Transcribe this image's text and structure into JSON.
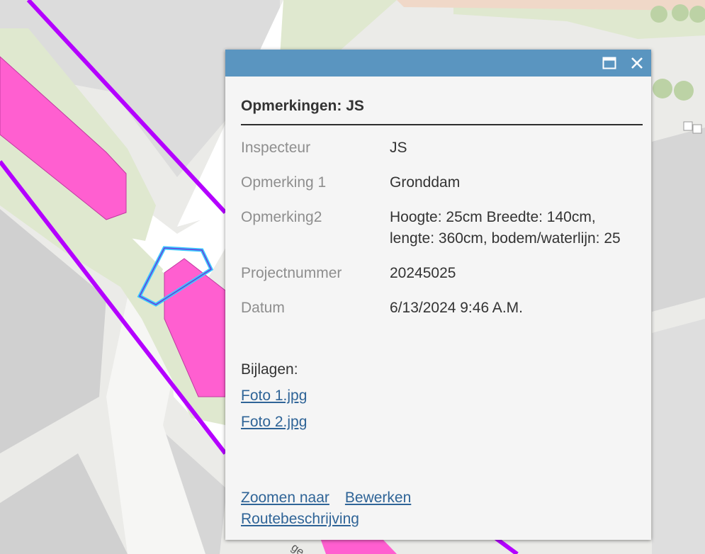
{
  "popup": {
    "title": "Opmerkingen: JS",
    "attributes": [
      {
        "label": "Inspecteur",
        "value": "JS"
      },
      {
        "label": "Opmerking 1",
        "value": "Gronddam"
      },
      {
        "label": "Opmerking2",
        "value": "Hoogte: 25cm Breedte: 140cm, lengte: 360cm, bodem/waterlijn: 25"
      },
      {
        "label": "Projectnummer",
        "value": "20245025"
      },
      {
        "label": "Datum",
        "value": "6/13/2024 9:46 A.M."
      }
    ],
    "attachments_label": "Bijlagen:",
    "attachments": [
      "Foto 1.jpg",
      "Foto 2.jpg"
    ],
    "actions": {
      "zoom": "Zoomen naar",
      "edit": "Bewerken",
      "route": "Routebeschrijving"
    },
    "header_icons": [
      "maximize-icon",
      "close-icon"
    ]
  },
  "map": {
    "street_label_fragment": "ge",
    "colors": {
      "background": "#ebebe8",
      "road": "#ffffff",
      "building": "#d3d3d3",
      "green": "#dfe8cf",
      "pink_feature": "#ff5fd0",
      "purple_line": "#b400ff",
      "cyan_outline": "#3cc8ff",
      "header": "#5a95c0",
      "link": "#2f6497"
    }
  }
}
